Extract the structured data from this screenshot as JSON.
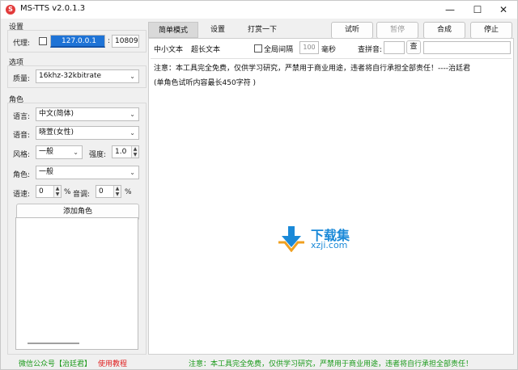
{
  "window": {
    "title": "MS-TTS v2.0.1.3",
    "icon_letter": "S",
    "min": "—",
    "max": "☐",
    "close": "✕"
  },
  "settings": {
    "group_label": "设置",
    "proxy_label": "代理:",
    "proxy_host": "127.0.0.1",
    "proxy_sep": ":",
    "proxy_port": "10809"
  },
  "options": {
    "group_label": "选项",
    "quality_label": "质量:",
    "quality_value": "16khz-32kbitrate"
  },
  "role": {
    "group_label": "角色",
    "language_label": "语言:",
    "language_value": "中文(简体)",
    "voice_label": "语音:",
    "voice_value": "晓萱(女性)",
    "style_label": "风格:",
    "style_value": "一般",
    "intensity_label": "强度:",
    "intensity_value": "1.0",
    "character_label": "角色:",
    "character_value": "一般",
    "speed_label": "语速:",
    "speed_value": "0",
    "speed_unit": "%",
    "pitch_label": "音调:",
    "pitch_value": "0",
    "pitch_unit": "%",
    "add_button": "添加角色"
  },
  "tabs": [
    "简单模式",
    "设置",
    "打赏一下"
  ],
  "actions": {
    "listen": "试听",
    "pause": "暂停",
    "synth": "合成",
    "stop": "停止"
  },
  "subtabs": {
    "short_text": "中小文本",
    "long_text": "超长文本",
    "global_interval": "全局间隔",
    "interval_value": "100",
    "interval_unit": "毫秒",
    "pinyin_label": "查拼音:",
    "pinyin_value": "",
    "query_button": "查"
  },
  "content": {
    "line1": "注意：本工具完全免费，仅供学习研究，严禁用于商业用途，违者将自行承担全部责任！----治廷君",
    "line2": "(单角色试听内容最长450字符 )"
  },
  "watermark": {
    "cn": "下载集",
    "url": "xzji.com"
  },
  "status": {
    "wechat": "微信公众号【治廷君】",
    "tutorial": "使用教程",
    "notice": "注意：本工具完全免费，仅供学习研究，严禁用于商业用途，违者将自行承担全部责任！"
  },
  "colors": {
    "green": "#1a9a1a",
    "red": "#e02020",
    "blue": "#1a89d8"
  }
}
